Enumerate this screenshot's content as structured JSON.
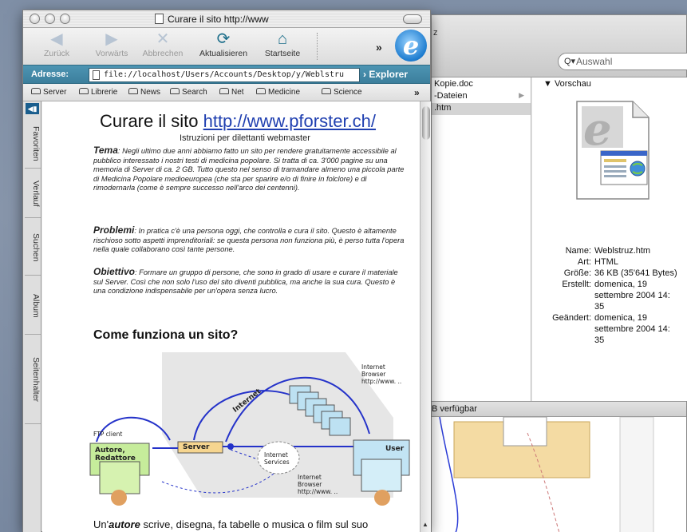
{
  "finder": {
    "z_char": "z",
    "search_placeholder": "Auswahl",
    "files": [
      {
        "name": "Kopie.doc"
      },
      {
        "name": "-Dateien"
      },
      {
        "name": ".htm"
      }
    ],
    "preview_header": "Vorschau",
    "info": {
      "name_label": "Name:",
      "name_value": "Weblstruz.htm",
      "kind_label": "Art:",
      "kind_value": "HTML",
      "size_label": "Größe:",
      "size_value": "36 KB (35'641 Bytes)",
      "created_label": "Erstellt:",
      "created_value": [
        "domenica, 19",
        "settembre 2004 14:",
        "35"
      ],
      "modified_label": "Geändert:",
      "modified_value": [
        "domenica, 19",
        "settembre 2004 14:",
        "35"
      ]
    },
    "status_text": "B verfügbar"
  },
  "browser": {
    "title": "Curare il sito http://www",
    "toolbar": {
      "back": "Zurück",
      "forward": "Vorwärts",
      "stop": "Abbrechen",
      "refresh": "Aktualisieren",
      "home": "Startseite",
      "more": "»"
    },
    "address_label": "Adresse:",
    "address_value": "file://localhost/Users/Accounts/Desktop/y/Weblstru",
    "explorer_label": "Explorer",
    "favorites": [
      "Server",
      "Librerie",
      "News",
      "Search",
      "Net",
      "Medicine",
      "Science"
    ],
    "favorites_more": "»",
    "sidebar_tabs": [
      "Favoriten",
      "Verlauf",
      "Suchen",
      "Album",
      "Seitenhalter"
    ],
    "page": {
      "title_text": "Curare il sito ",
      "title_link": "http://www.pforster.ch/",
      "subtitle": "Istruzioni per dilettanti webmaster",
      "p1_lead": "Tema",
      "p1": ": Negli ultimo due anni abbiamo fatto un sito per rendere gratuitamente accessibile al pubblico interessato i nostri testi di medicina popolare. Si tratta di ca. 3'000 pagine su una memoria di Server di ca. 2 GB. Tutto questo nel senso di tramandare almeno una piccola parte di Medicina Popolare medioeuropea (che sta per sparire e/o di finire in folclore) e di rimodernarla (come è sempre successo nell'arco dei centenni).",
      "p2_lead": "Problemi",
      "p2": ": In pratica c'è una persona oggi, che controlla e cura il sito. Questo è altamente rischioso sotto aspetti imprenditoriali: se questa persona non funziona più, è perso tutta l'opera nella quale collaborano così tante persone.",
      "p3_lead": "Obiettivo",
      "p3": ": Formare un gruppo di persone, che sono in grado di usare e curare il materiale sul Server. Così che non solo l'uso del sito diventi pubblica, ma anche la sua cura. Questo è una condizione indispensabile per un'opera senza lucro.",
      "h2": "Come funziona un sito?",
      "diagram": {
        "ftp": "FTP client",
        "author": "Autore, Redattore",
        "server": "Server",
        "internet": "Internet",
        "services": "Internet Services",
        "user": "User",
        "browser1": "Internet Browser http://www. ..",
        "browser2": "Internet Browser http://www. .."
      },
      "bottom_pre": "Un'",
      "bottom_bold": "autore",
      "bottom_post": " scrive, disegna, fa tabelle o musica o film sul suo"
    }
  }
}
